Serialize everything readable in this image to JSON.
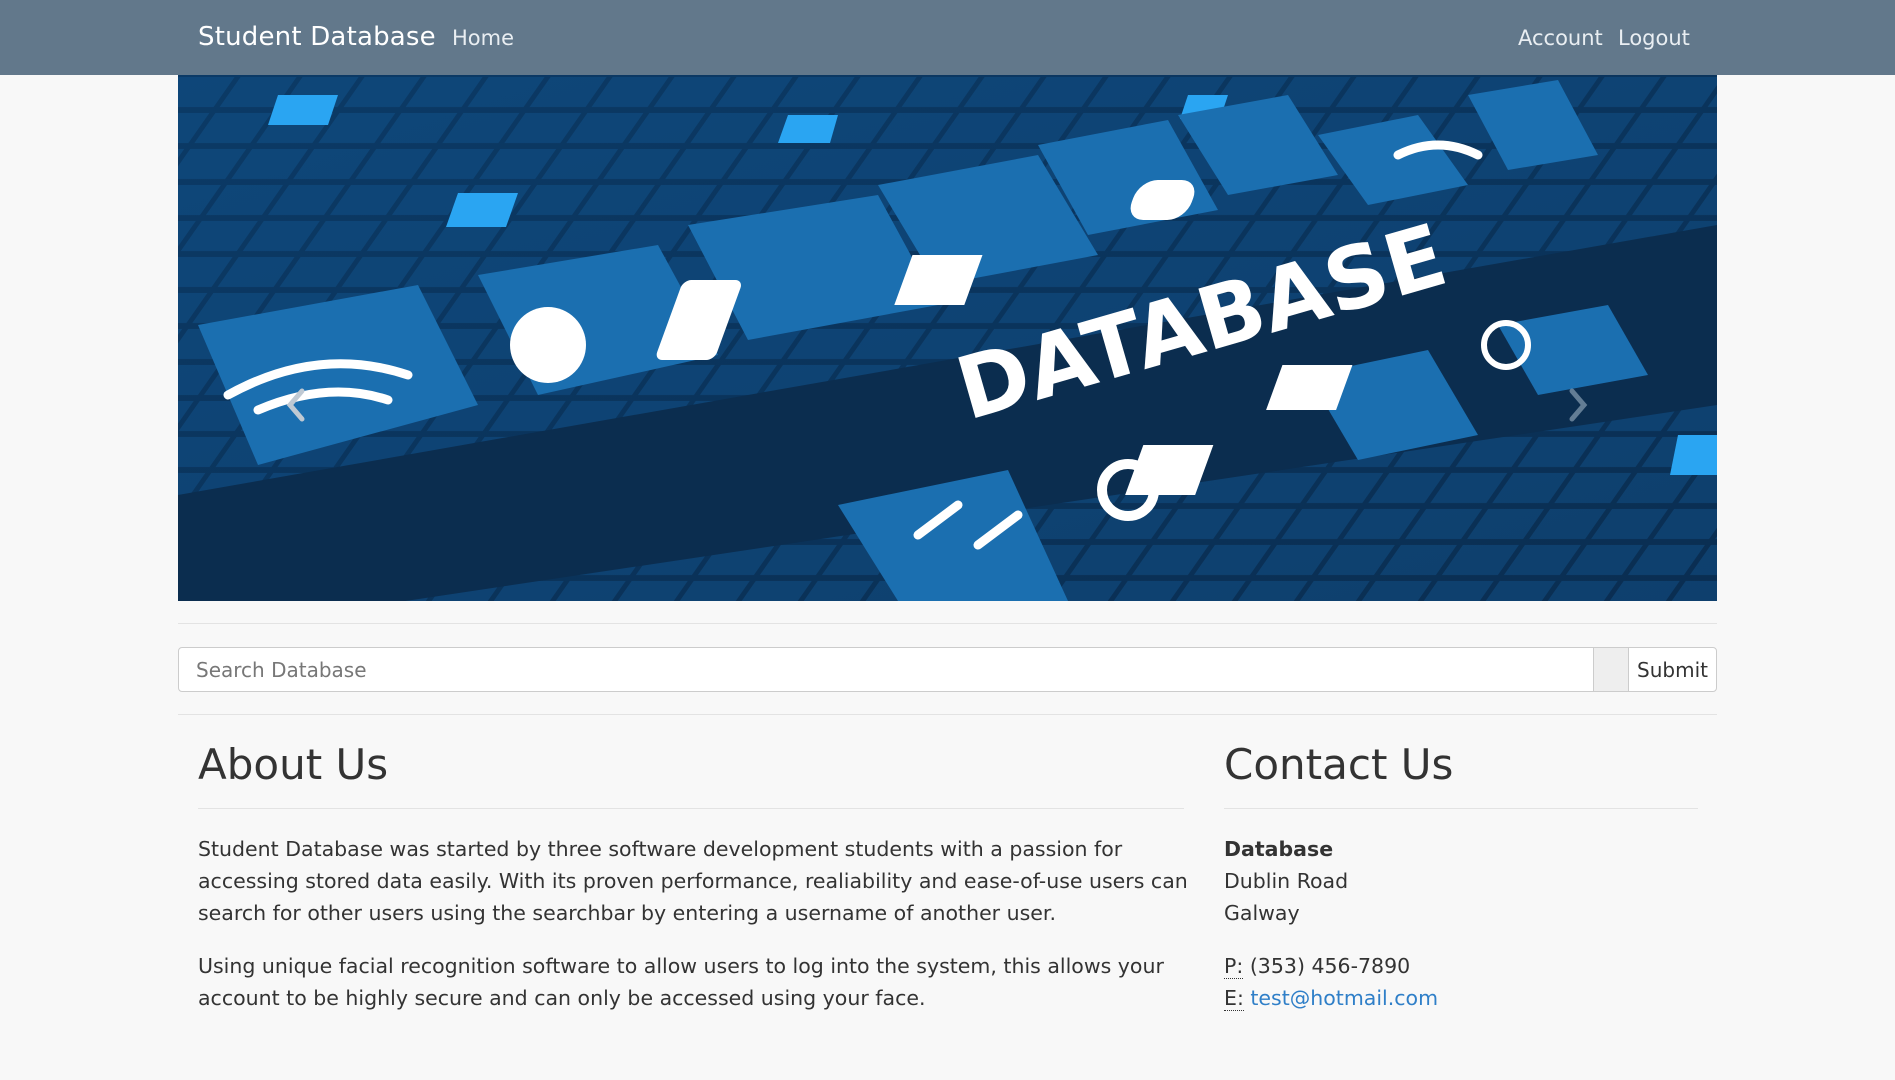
{
  "navbar": {
    "brand": "Student Database",
    "home": "Home",
    "account": "Account",
    "logout": "Logout",
    "bg_color": "#62788b"
  },
  "carousel": {
    "banner_text": "DATABASE",
    "prev_icon": "chevron-left-icon",
    "next_icon": "chevron-right-icon"
  },
  "search": {
    "placeholder": "Search Database",
    "value": "",
    "submit_label": "Submit"
  },
  "about": {
    "title": "About Us",
    "paragraph1": "Student Database was started by three software development students with a passion for accessing stored data easily. With its proven performance, realiability and ease-of-use users can search for other users using the searchbar by entering a username of another user.",
    "paragraph2": "Using unique facial recognition software to allow users to log into the system, this allows your account to be highly secure and can only be accessed using your face."
  },
  "contact": {
    "title": "Contact Us",
    "org": "Database",
    "street": "Dublin Road",
    "city": "Galway",
    "phone_label": "P:",
    "phone": "(353) 456-7890",
    "email_label": "E:",
    "email": "test@hotmail.com",
    "link_color": "#2f7fc8"
  }
}
